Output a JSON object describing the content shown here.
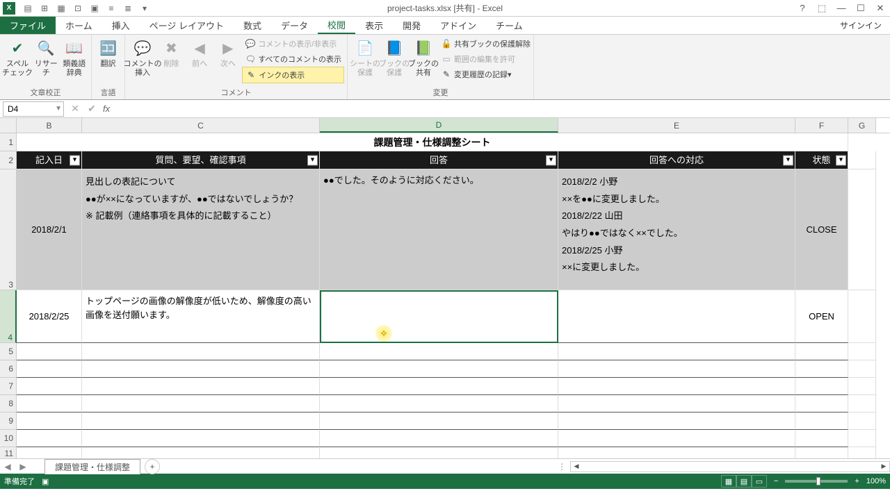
{
  "titleBar": {
    "fileName": "project-tasks.xlsx  [共有]  -  Excel"
  },
  "ribbonTabs": {
    "file": "ファイル",
    "home": "ホーム",
    "insert": "挿入",
    "pageLayout": "ページ レイアウト",
    "formulas": "数式",
    "data": "データ",
    "review": "校閲",
    "view": "表示",
    "developer": "開発",
    "addins": "アドイン",
    "team": "チーム",
    "signin": "サインイン"
  },
  "ribbon": {
    "group1": {
      "label": "文章校正",
      "spellcheck": "スペル\nチェック",
      "research": "リサーチ",
      "thesaurus": "類義語\n辞典"
    },
    "group2": {
      "label": "言語",
      "translate": "翻訳"
    },
    "group3": {
      "label": "コメント",
      "newComment": "コメントの\n挿入",
      "delete": "削除",
      "prev": "前へ",
      "next": "次へ",
      "showHide": "コメントの表示/非表示",
      "showAll": "すべてのコメントの表示",
      "ink": "インクの表示"
    },
    "group4": {
      "label": "",
      "protectSheet": "シートの\n保護",
      "protectWorkbook": "ブックの\n保護",
      "shareWorkbook": "ブックの\n共有"
    },
    "group5": {
      "label": "変更",
      "unshare": "共有ブックの保護解除",
      "allowRanges": "範囲の編集を許可",
      "trackChanges": "変更履歴の記録"
    }
  },
  "formulaBar": {
    "nameBox": "D4"
  },
  "columns": {
    "B": "B",
    "C": "C",
    "D": "D",
    "E": "E",
    "F": "F",
    "G": "G"
  },
  "sheet": {
    "titleRow": "課題管理・仕様調整シート",
    "headers": {
      "B": "記入日",
      "C": "質問、要望、確認事項",
      "D": "回答",
      "E": "回答への対応",
      "F": "状態"
    },
    "row3": {
      "B": "2018/2/1",
      "C": "見出しの表記について\n●●が××になっていますが、●●ではないでしょうか？\n※ 記載例（連絡事項を具体的に記載すること）",
      "D": "●●でした。そのように対応ください。",
      "E": "2018/2/2 小野\n××を●●に変更しました。\n2018/2/22 山田\nやはり●●ではなく××でした。\n2018/2/25 小野\n××に変更しました。",
      "F": "CLOSE"
    },
    "row4": {
      "B": "2018/2/25",
      "C": "トップページの画像の解像度が低いため、解像度の高い画像を送付願います。",
      "D": "",
      "E": "",
      "F": "OPEN"
    }
  },
  "sheetTab": {
    "name": "課題管理・仕様調整"
  },
  "statusBar": {
    "ready": "準備完了",
    "zoom": "100%"
  }
}
